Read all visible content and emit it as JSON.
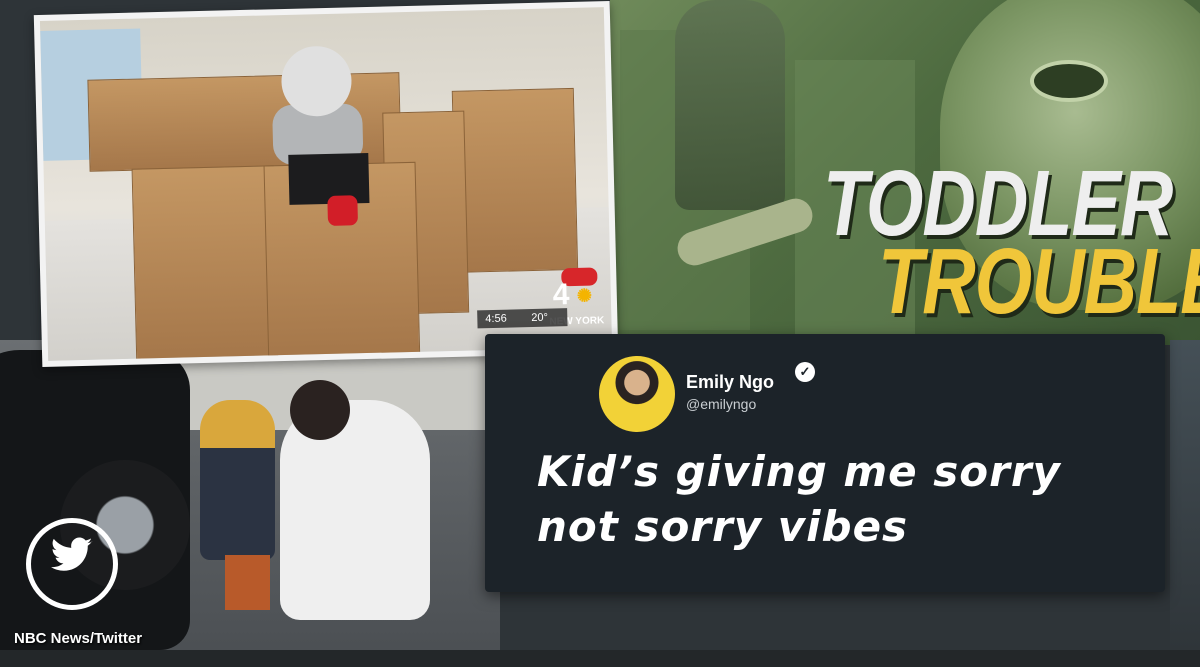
{
  "news_graphic": {
    "headline_line1": "TODDLER",
    "headline_line2": "TROUBLE",
    "colors": {
      "headline_white": "#eeeeee",
      "headline_yellow": "#f0c63a",
      "money_green": "#4e6b40"
    }
  },
  "top_photo": {
    "station_number": "4",
    "station_city": "NEW YORK",
    "time": "4:56",
    "temperature": "20°"
  },
  "tweet": {
    "author_name": "Emily Ngo",
    "handle": "@emilyngo",
    "verified_icon": "verified-check-icon",
    "text": "Kid’s giving me sorry not sorry vibes"
  },
  "branding": {
    "twitter_icon": "twitter-bird-icon",
    "credit": "NBC News/Twitter"
  }
}
